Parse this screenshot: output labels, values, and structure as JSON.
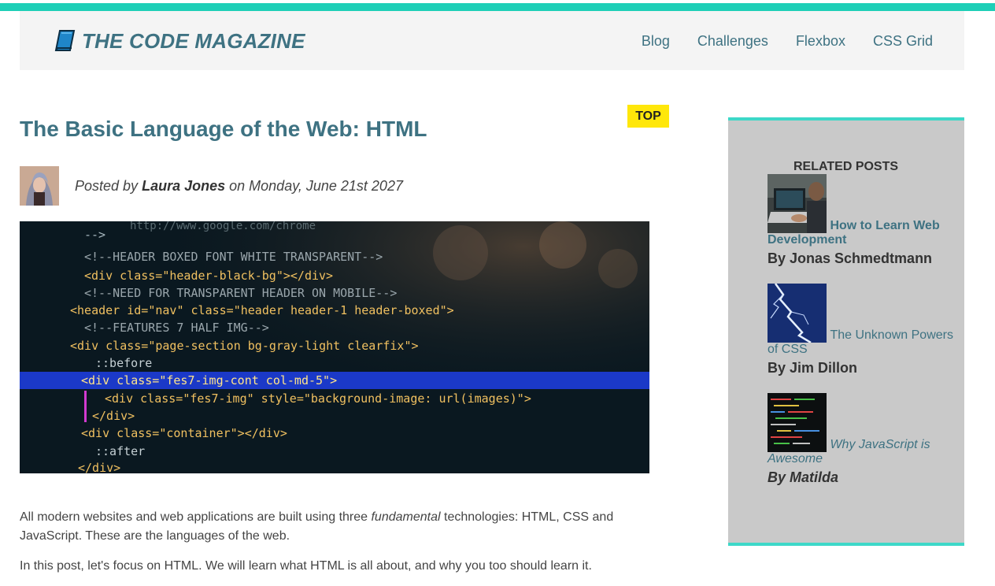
{
  "brand": {
    "name": "THE CODE MAGAZINE",
    "accent": "#1ecfb7",
    "link_color": "#3e7282"
  },
  "nav": {
    "items": [
      {
        "label": "Blog"
      },
      {
        "label": "Challenges"
      },
      {
        "label": "Flexbox"
      },
      {
        "label": "CSS Grid"
      }
    ]
  },
  "article": {
    "tag": "TOP",
    "title": "The Basic Language of the Web: HTML",
    "byline_prefix": "Posted by",
    "author": "Laura Jones",
    "byline_on": "on Monday, June 21st 2027",
    "hero_code": [
      "-->",
      "<!--HEADER BOXED FONT WHITE TRANSPARENT-->",
      "<div class=\"header-black-bg\"></div>",
      "<!--NEED FOR TRANSPARENT HEADER ON MOBILE-->",
      "<header id=\"nav\" class=\"header header-1 header-boxed\">",
      "<!--FEATURES 7 HALF IMG-->",
      "<div class=\"page-section bg-gray-light clearfix\">",
      "::before",
      "<div class=\"fes7-img-cont col-md-5\">",
      "<div class=\"fes7-img\" style=\"background-image: url(images)\">",
      "</div>",
      "<div class=\"container\"></div>",
      "::after",
      "</div>"
    ],
    "hero_url": "http://www.google.com/chrome",
    "para1_a": "All modern websites and web applications are built using three ",
    "para1_em": "fundamental",
    "para1_b": " technologies: HTML, CSS and JavaScript. These are the languages of the web.",
    "para2": "In this post, let's focus on HTML. We will learn what HTML is all about, and why you too should learn it."
  },
  "sidebar": {
    "title": "RELATED POSTS",
    "posts": [
      {
        "title": "How to Learn Web Development",
        "author": "By Jonas Schmedtmann",
        "thumb": "laptop-photo"
      },
      {
        "title": "The Unknown Powers of CSS",
        "author": "By Jim Dillon",
        "thumb": "lightning-photo"
      },
      {
        "title": "Why JavaScript is Awesome",
        "author": "By Matilda",
        "thumb": "code-screen-photo"
      }
    ]
  }
}
